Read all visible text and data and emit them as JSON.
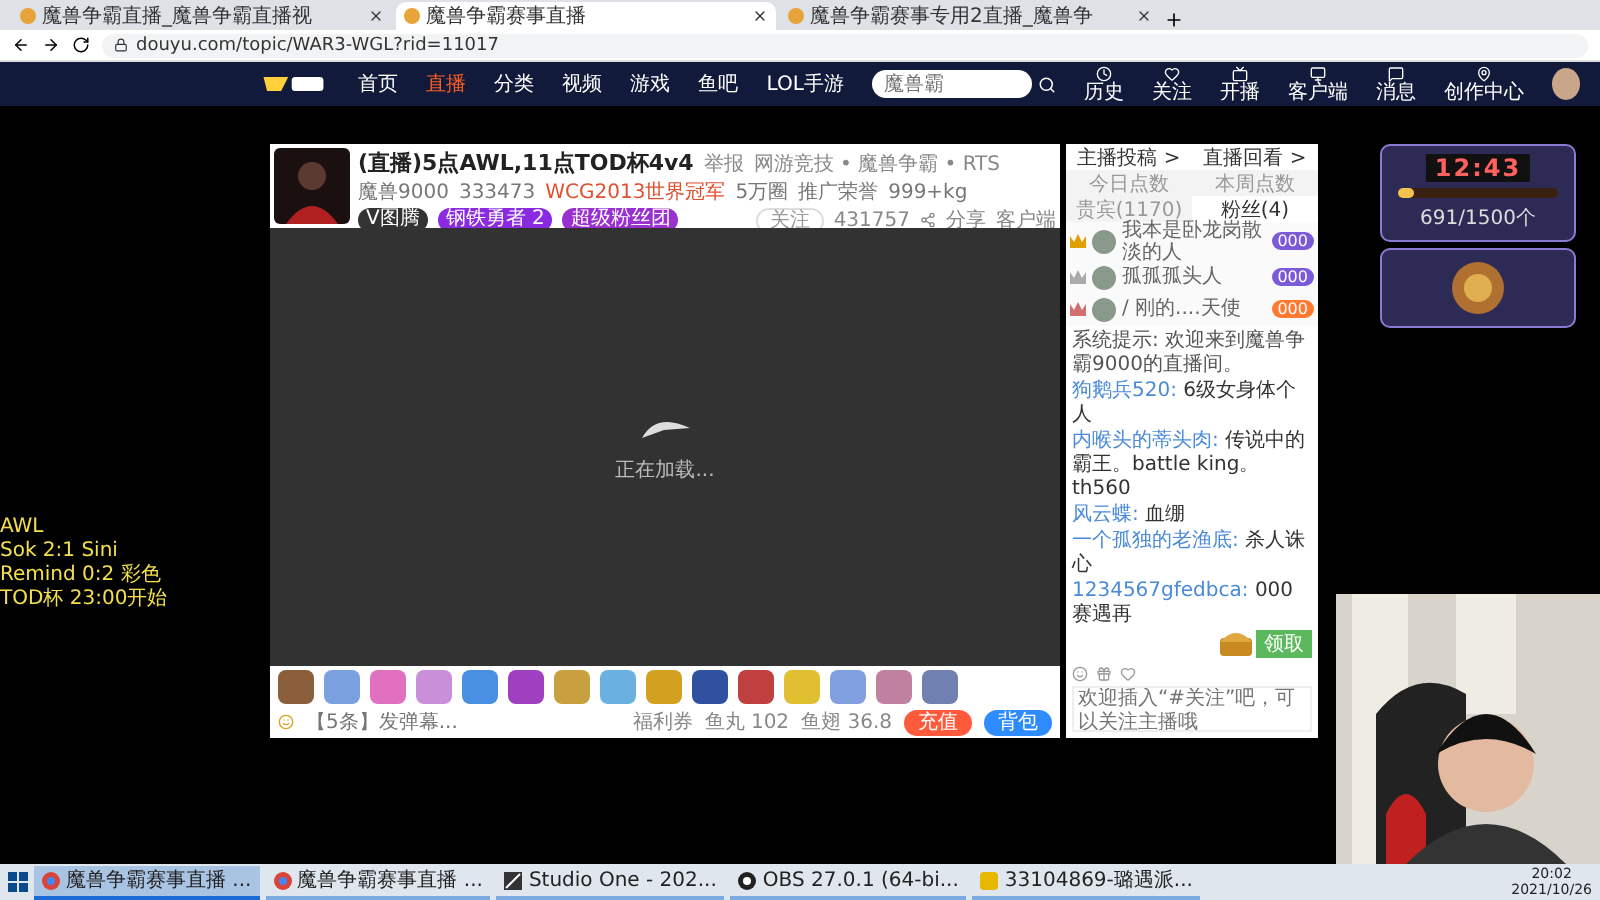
{
  "browser": {
    "tabs": [
      {
        "title": "魔兽争霸直播_魔兽争霸直播视",
        "selected": false
      },
      {
        "title": "魔兽争霸赛事直播",
        "selected": true
      },
      {
        "title": "魔兽争霸赛事专用2直播_魔兽争",
        "selected": false
      }
    ],
    "url": "douyu.com/topic/WAR3-WGL?rid=11017"
  },
  "site_nav": {
    "items": [
      {
        "label": "首页",
        "selected": false
      },
      {
        "label": "直播",
        "selected": true
      },
      {
        "label": "分类",
        "selected": false
      },
      {
        "label": "视频",
        "selected": false
      },
      {
        "label": "游戏",
        "selected": false
      },
      {
        "label": "鱼吧",
        "selected": false
      },
      {
        "label": "LOL手游",
        "selected": false
      }
    ],
    "search": {
      "placeholder": "魔兽霸"
    },
    "actions": [
      "历史",
      "关注",
      "开播",
      "客户端",
      "消息",
      "创作中心"
    ]
  },
  "overlay_text": [
    "AWL",
    "Sok 2:1 Sini",
    "Remind 0:2 彩色",
    "TOD杯 23:00开始"
  ],
  "player": {
    "title": "(直播)5点AWL,11点TOD杯4v4",
    "report": "举报",
    "category": "网游竞技 • 魔兽争霸 • RTS",
    "meta": [
      "魔兽9000",
      "333473",
      "WCG2013世界冠军",
      "5万圈",
      "推广荣誉",
      "999+kg"
    ],
    "badges": [
      "V图腾",
      "钢铁勇者 2",
      "超级粉丝团"
    ],
    "follow": "关注",
    "followers": "431757",
    "share": "分享",
    "client": "客户端",
    "loading": "正在加载...",
    "chat_placeholder": "【5条】发弹幕...",
    "coupon": "福利券",
    "fish_balls": "鱼丸 102",
    "fish_fins": "鱼翅 36.8",
    "buttons": [
      "充值",
      "背包"
    ]
  },
  "chat": {
    "links": [
      "主播投稿 >",
      "直播回看 >"
    ],
    "tabs": [
      {
        "label": "今日点数",
        "selected": false
      },
      {
        "label": "本周点数",
        "selected": false
      },
      {
        "label": "贵宾(1170)",
        "selected": false
      },
      {
        "label": "粉丝(4)",
        "selected": true
      }
    ],
    "ranks": [
      {
        "name": "我本是卧龙岗散淡的人",
        "score": "000"
      },
      {
        "name": "孤孤孤头人",
        "score": "000"
      },
      {
        "name": "/ 刚的....天使",
        "score": "000"
      }
    ],
    "system": "系统提示: 欢迎来到魔兽争霸9000的直播间。",
    "messages": [
      {
        "user": "狗鹅兵520:",
        "text": "6级女身体个人"
      },
      {
        "user": "内喉头的蒂头肉:",
        "text": "传说中的霸王。battle king。th560"
      },
      {
        "user": "风云蝶:",
        "text": "血绷"
      },
      {
        "user": "一个孤独的老渔底:",
        "text": "杀人诛心"
      },
      {
        "user": "1234567gfedbca:",
        "text": "000赛遇再"
      }
    ],
    "chest_button": "领取",
    "input_placeholder": "欢迎插入“#关注”吧，可以关注主播哦"
  },
  "widgets": {
    "timer": "12:43",
    "progress": {
      "text": "691/1500个",
      "level": 0.1
    }
  },
  "taskbar": {
    "items": [
      {
        "title": "魔兽争霸赛事直播 ...",
        "kind": "browser",
        "selected": true
      },
      {
        "title": "魔兽争霸赛事直播 ...",
        "kind": "browser",
        "selected": false
      },
      {
        "title": "Studio One - 202...",
        "kind": "daw",
        "selected": false
      },
      {
        "title": "OBS 27.0.1 (64-bi...",
        "kind": "obs",
        "selected": false
      },
      {
        "title": "33104869-璐遇派...",
        "kind": "chat",
        "selected": false
      }
    ],
    "time": "20:02",
    "date": "2021/10/26"
  }
}
